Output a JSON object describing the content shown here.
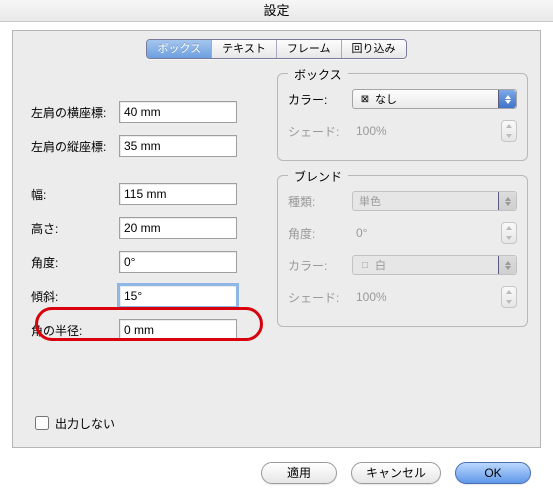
{
  "title": "設定",
  "tabs": [
    "ボックス",
    "テキスト",
    "フレーム",
    "回り込み"
  ],
  "active_tab": 0,
  "left": {
    "x_label": "左肩の横座標:",
    "x_value": "40 mm",
    "y_label": "左肩の縦座標:",
    "y_value": "35 mm",
    "w_label": "幅:",
    "w_value": "115 mm",
    "h_label": "高さ:",
    "h_value": "20 mm",
    "angle_label": "角度:",
    "angle_value": "0°",
    "skew_label": "傾斜:",
    "skew_value": "15°",
    "radius_label": "角の半径:",
    "radius_value": "0 mm"
  },
  "box_group": {
    "title": "ボックス",
    "color_label": "カラー:",
    "color_value": "なし",
    "color_icon": "⊠",
    "shade_label": "シェード:",
    "shade_value": "100%"
  },
  "blend_group": {
    "title": "ブレンド",
    "type_label": "種類:",
    "type_value": "単色",
    "angle_label": "角度:",
    "angle_value": "0°",
    "color_label": "カラー:",
    "color_value": "白",
    "color_icon": "□",
    "shade_label": "シェード:",
    "shade_value": "100%"
  },
  "suppress_label": "出力しない",
  "buttons": {
    "apply": "適用",
    "cancel": "キャンセル",
    "ok": "OK"
  }
}
